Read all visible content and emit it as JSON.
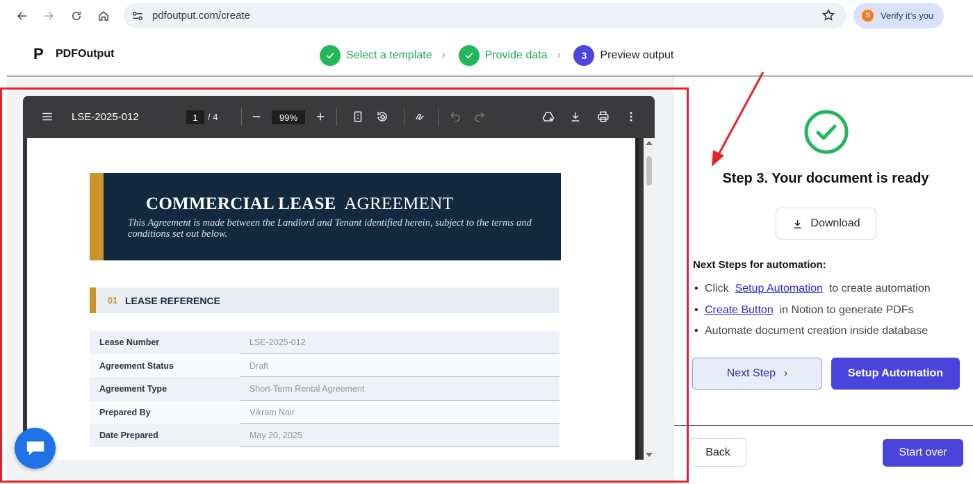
{
  "browser": {
    "url": "pdfoutput.com/create",
    "profile_initial": "S",
    "profile_label": "Verify it's you"
  },
  "app": {
    "logo_mark": "P",
    "name": "PDFOutput"
  },
  "steps": [
    {
      "label": "Select a template",
      "status": "done"
    },
    {
      "label": "Provide data",
      "status": "done"
    },
    {
      "label": "Preview output",
      "status": "current",
      "number": "3"
    }
  ],
  "viewer": {
    "doc_title": "LSE-2025-012",
    "current_page": "1",
    "total_pages": "/  4",
    "zoom": "99%"
  },
  "document": {
    "title_bold": "COMMERCIAL LEASE",
    "title_rest": "AGREEMENT",
    "subtitle": "This Agreement is made between the Landlord and Tenant identified herein, subject to the terms and conditions set out below.",
    "section_number": "01",
    "section_title": "LEASE REFERENCE",
    "rows": [
      {
        "key": "Lease Number",
        "value": "LSE-2025-012"
      },
      {
        "key": "Agreement Status",
        "value": "Draft"
      },
      {
        "key": "Agreement Type",
        "value": "Short-Term Rental Agreement"
      },
      {
        "key": "Prepared By",
        "value": "Vikram Nair"
      },
      {
        "key": "Date Prepared",
        "value": "May 20, 2025"
      }
    ]
  },
  "panel": {
    "ready_title": "Step 3. Your document is ready",
    "download_label": "Download",
    "next_steps_title": "Next Steps for automation:",
    "item1_pre": "Click",
    "item1_link": "Setup Automation",
    "item1_post": "to create automation",
    "item2_link": "Create Button",
    "item2_post": "in Notion to generate PDFs",
    "item3": "Automate document creation inside database",
    "next_step_label": "Next Step",
    "setup_label": "Setup Automation",
    "back_label": "Back",
    "start_over_label": "Start over"
  },
  "colors": {
    "accent": "#4a44dc",
    "success": "#22b85a",
    "annotation_red": "#e1252b",
    "doc_navy": "#12293f",
    "doc_gold": "#c9952d"
  }
}
